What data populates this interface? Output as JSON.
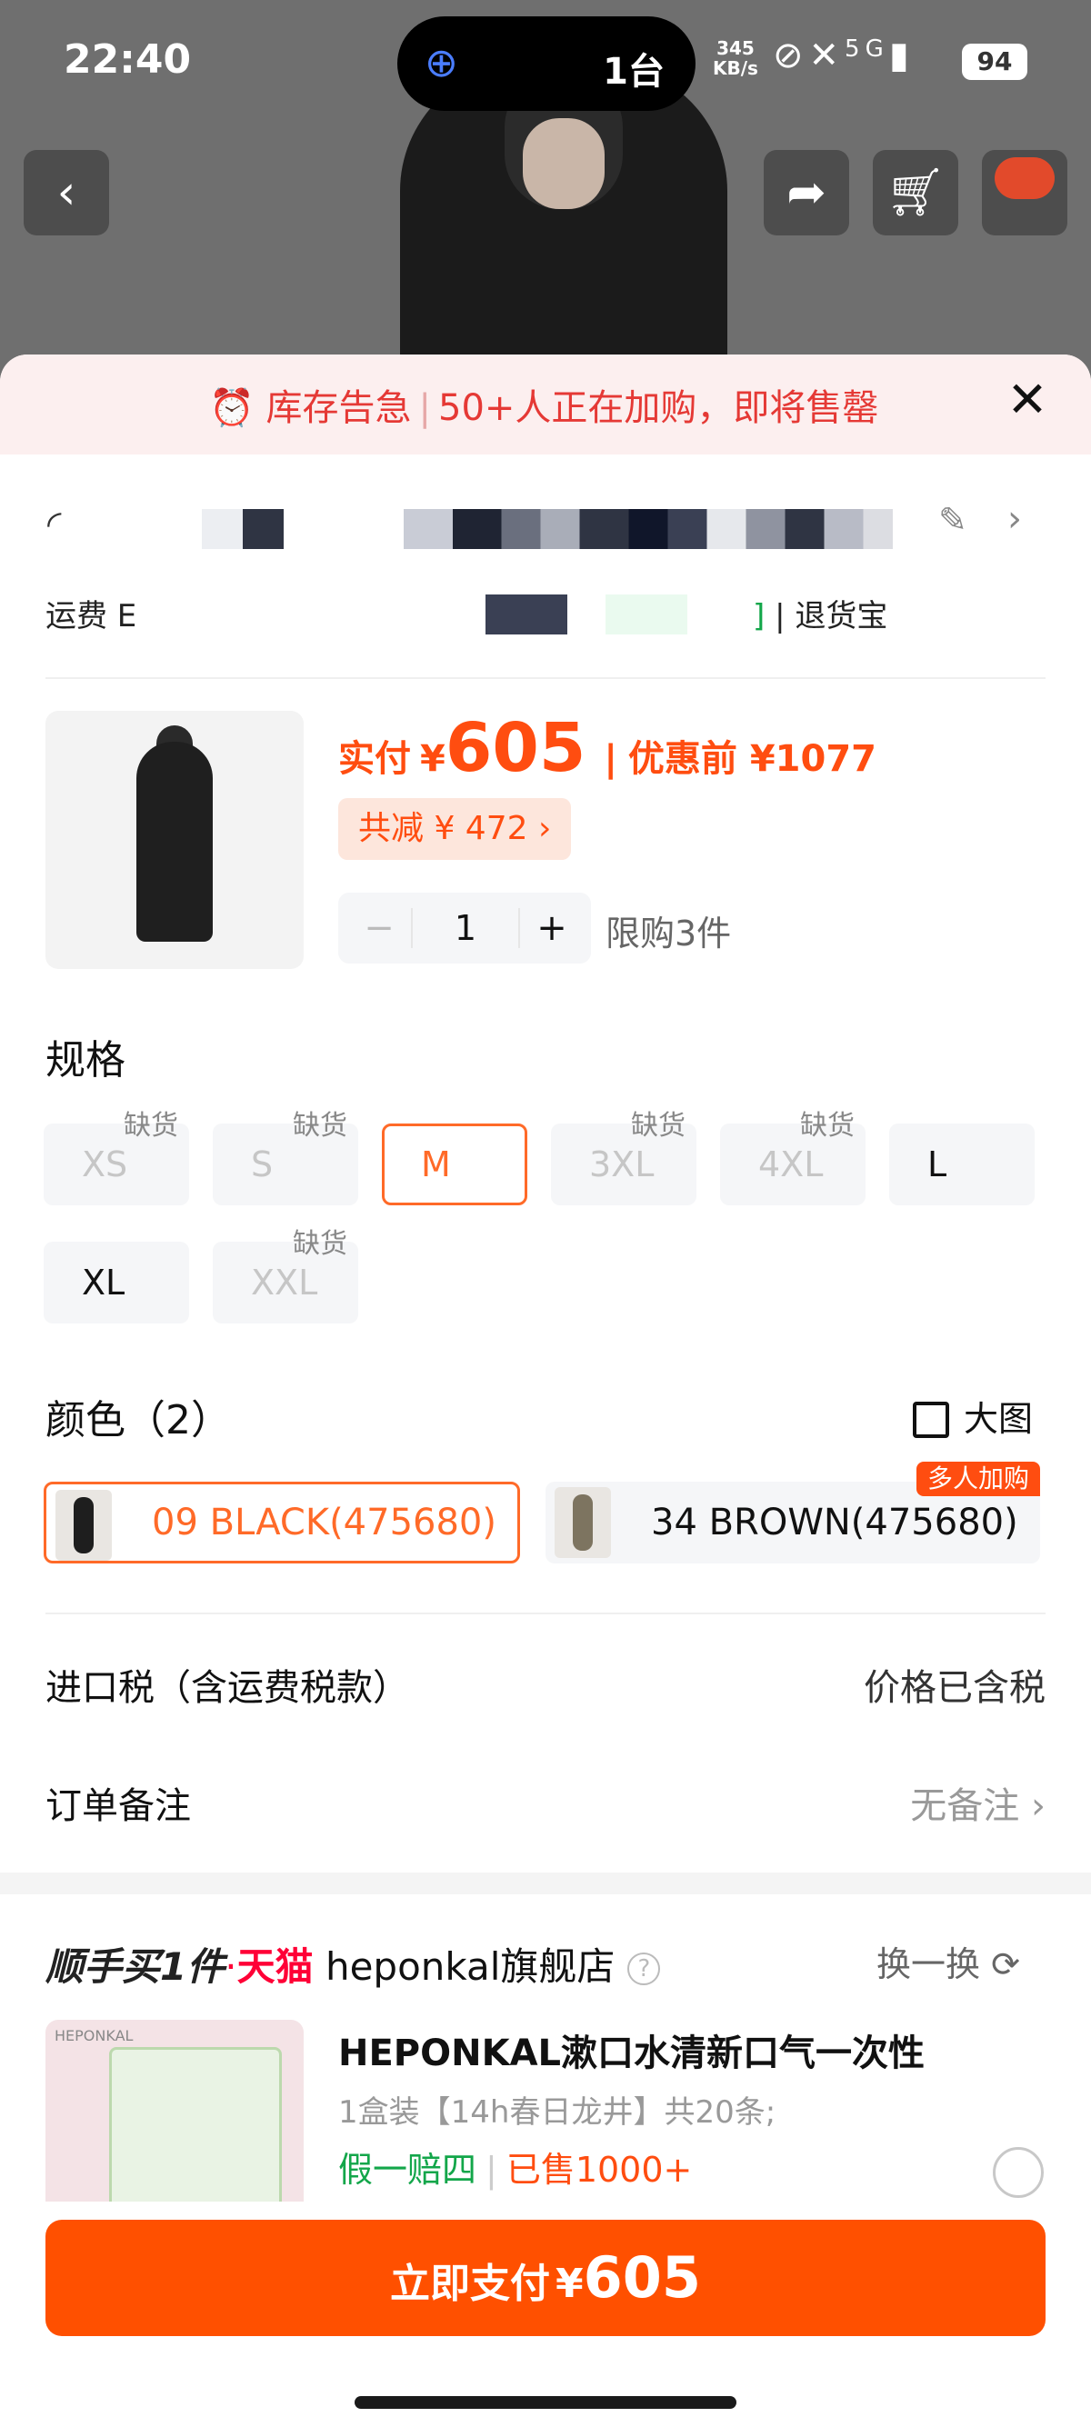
{
  "status_bar": {
    "time": "22:40",
    "island_count": "1台",
    "speed_top": "345",
    "speed_bottom": "KB/s",
    "network": "5G",
    "battery": "94"
  },
  "alert": {
    "label1": "库存告急",
    "label2": "50+人正在加购，即将售罄"
  },
  "address": {
    "shipping_label": "运费 E",
    "return_service": "退货宝"
  },
  "product": {
    "paid_label": "实付",
    "currency": "¥",
    "paid_price": "605",
    "before_label": "优惠前 ¥1077",
    "discount": "共减 ¥ 472 ›",
    "quantity": "1",
    "minus": "−",
    "plus": "+",
    "limit": "限购3件"
  },
  "spec": {
    "title": "规格",
    "out_of_stock": "缺货",
    "sizes": [
      {
        "label": "XS",
        "state": "out"
      },
      {
        "label": "S",
        "state": "out"
      },
      {
        "label": "M",
        "state": "selected"
      },
      {
        "label": "3XL",
        "state": "out"
      },
      {
        "label": "4XL",
        "state": "out"
      },
      {
        "label": "L",
        "state": "available"
      },
      {
        "label": "XL",
        "state": "available"
      },
      {
        "label": "XXL",
        "state": "out"
      }
    ]
  },
  "color": {
    "title": "颜色（2）",
    "big_image": "大图",
    "options": [
      {
        "label": "09 BLACK(475680)",
        "selected": true
      },
      {
        "label": "34 BROWN(475680)",
        "badge": "多人加购"
      }
    ]
  },
  "tax": {
    "label": "进口税（含运费税款）",
    "value": "价格已含税"
  },
  "remark": {
    "label": "订单备注",
    "value": "无备注 ›"
  },
  "addon": {
    "prefix": "顺手买1件",
    "tmall": "天猫",
    "store": "heponkal旗舰店",
    "swap": "换一换",
    "brand": "HEPONKAL",
    "title": "HEPONKAL漱口水清新口气一次性",
    "subtitle": "1盒装【14h春日龙井】共20条;",
    "tag_quality": "假一赔四",
    "tag_sold": "已售1000+"
  },
  "pay": {
    "label": "立即支付",
    "currency": "¥",
    "amount": "605"
  },
  "colors": {
    "accent": "#ff5000",
    "alert_red": "#e53935",
    "green": "#13a64a"
  }
}
